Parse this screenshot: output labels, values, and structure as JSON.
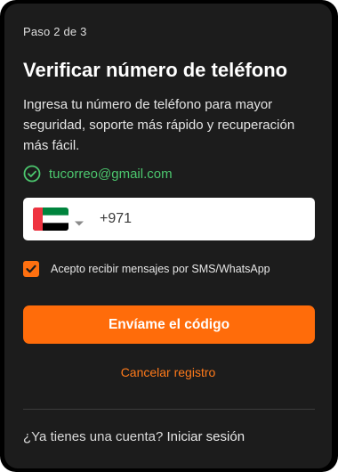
{
  "step": {
    "label": "Paso 2 de 3"
  },
  "header": {
    "title": "Verificar número de teléfono"
  },
  "description": "Ingresa tu número de teléfono para mayor seguridad, soporte más rápido y recuperación más fácil.",
  "email": {
    "value": "tucorreo@gmail.com",
    "verified_color": "#4cc76e",
    "icon": "check-circle-icon"
  },
  "phone": {
    "country_flag": "uae-flag-icon",
    "dropdown_icon": "caret-down-icon",
    "value": "+971"
  },
  "consent": {
    "checked": true,
    "label": "Acepto recibir mensajes por SMS/WhatsApp"
  },
  "actions": {
    "send_code_label": "Envíame el código",
    "cancel_label": "Cancelar registro"
  },
  "footer": {
    "question": "¿Ya tienes una cuenta?",
    "login_label": "Iniciar sesión"
  },
  "colors": {
    "accent": "#ff6c0a",
    "background": "#1c1c1c",
    "success": "#4cc76e"
  }
}
